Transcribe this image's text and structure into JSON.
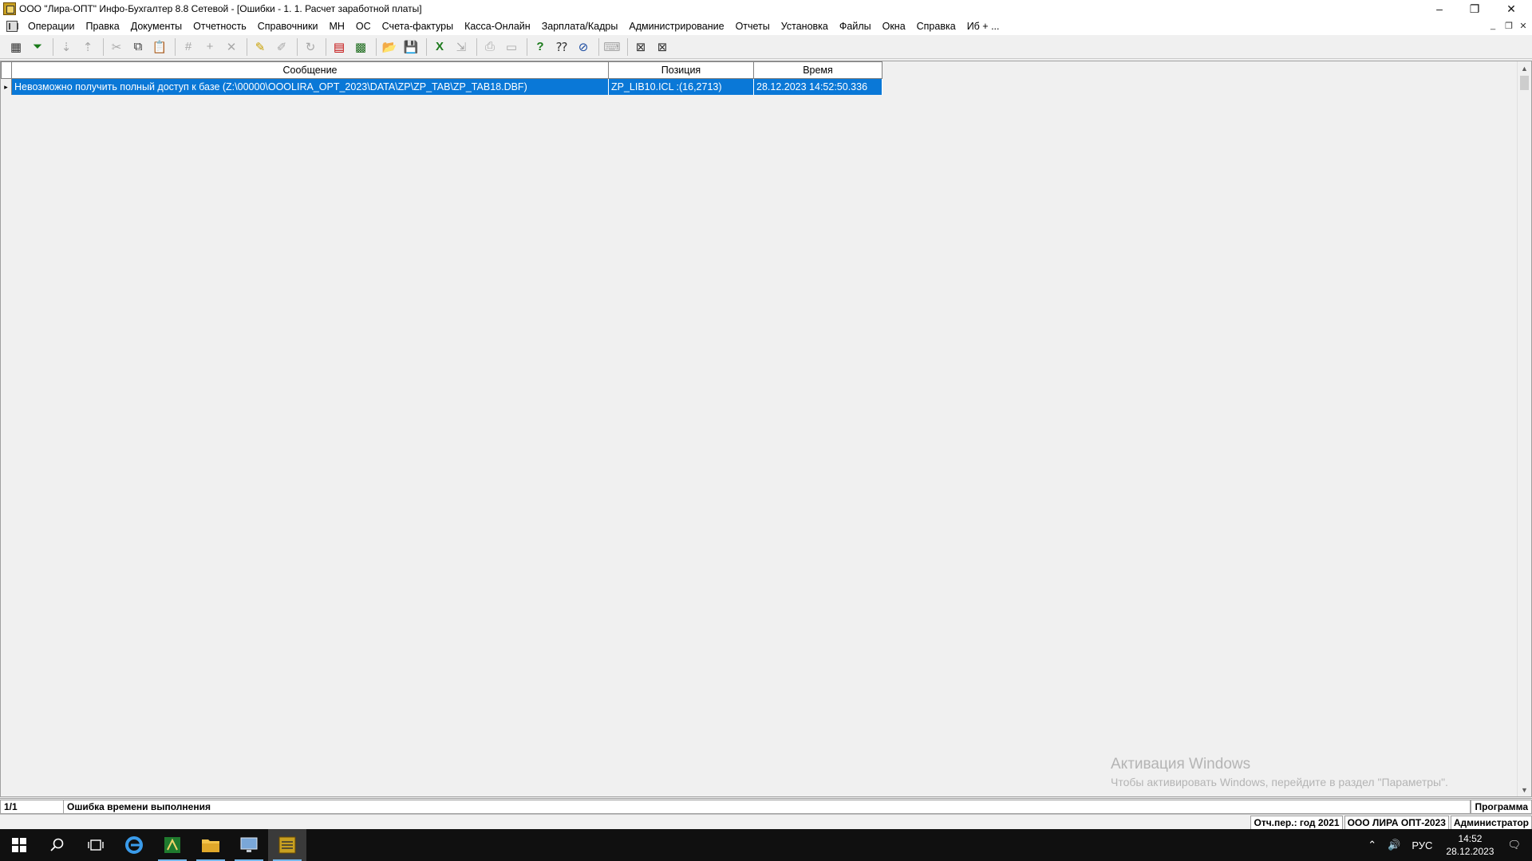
{
  "window": {
    "title": "ООО \"Лира-ОПТ\" Инфо-Бухгалтер 8.8 Сетевой - [Ошибки - 1. 1. Расчет заработной платы]",
    "controls": {
      "minimize": "–",
      "restore": "❐",
      "close": "✕"
    }
  },
  "menu": {
    "items": [
      "Операции",
      "Правка",
      "Документы",
      "Отчетность",
      "Справочники",
      "МН",
      "ОС",
      "Счета-фактуры",
      "Касса-Онлайн",
      "Зарплата/Кадры",
      "Администрирование",
      "Отчеты",
      "Установка",
      "Файлы",
      "Окна",
      "Справка",
      "Иб + ..."
    ],
    "mdi_controls": {
      "minimize": "_",
      "restore": "❐",
      "close": "✕"
    }
  },
  "toolbar": {
    "icons": [
      {
        "name": "table-view-icon",
        "glyph": "▦"
      },
      {
        "name": "filter-icon",
        "glyph": "⏷"
      },
      {
        "name": "sort-asc-icon",
        "glyph": "⇣"
      },
      {
        "name": "sort-desc-icon",
        "glyph": "⇡"
      },
      {
        "name": "cut-icon",
        "glyph": "✂"
      },
      {
        "name": "copy-icon",
        "glyph": "⧉"
      },
      {
        "name": "paste-icon",
        "glyph": "📋"
      },
      {
        "name": "numbering-icon",
        "glyph": "#"
      },
      {
        "name": "add-icon",
        "glyph": "+"
      },
      {
        "name": "delete-icon",
        "glyph": "✕"
      },
      {
        "name": "mark-icon",
        "glyph": "✎"
      },
      {
        "name": "unmark-icon",
        "glyph": "✐"
      },
      {
        "name": "refresh-icon",
        "glyph": "↻"
      },
      {
        "name": "pdf-icon",
        "glyph": "▤"
      },
      {
        "name": "calculator-icon",
        "glyph": "▩"
      },
      {
        "name": "open-folder-icon",
        "glyph": "📂"
      },
      {
        "name": "save-icon",
        "glyph": "💾"
      },
      {
        "name": "excel-icon",
        "glyph": "X"
      },
      {
        "name": "export-icon",
        "glyph": "⇲"
      },
      {
        "name": "print-icon",
        "glyph": "⎙"
      },
      {
        "name": "print-preview-icon",
        "glyph": "▭"
      },
      {
        "name": "help-icon",
        "glyph": "?"
      },
      {
        "name": "context-help-icon",
        "glyph": "⁇"
      },
      {
        "name": "compass-icon",
        "glyph": "⊘"
      },
      {
        "name": "keyboard-icon",
        "glyph": "⌨"
      },
      {
        "name": "close-window-icon",
        "glyph": "⊠"
      },
      {
        "name": "close-all-icon",
        "glyph": "⊠"
      }
    ]
  },
  "grid": {
    "columns": [
      "Сообщение",
      "Позиция",
      "Время"
    ],
    "rows": [
      {
        "message": "Невозможно получить полный доступ к базе  (Z:\\00000\\OOOLIRA_OPT_2023\\DATA\\ZP\\ZP_TAB\\ZP_TAB18.DBF)",
        "position": "ZP_LIB10.ICL :(16,2713)",
        "time": "28.12.2023 14:52:50.336"
      }
    ],
    "row_indicator": "▸",
    "scroll_up": "▲",
    "scroll_down": "▼"
  },
  "watermark": {
    "title": "Активация Windows",
    "subtitle": "Чтобы активировать Windows, перейдите в раздел \"Параметры\"."
  },
  "status": {
    "record": "1/1",
    "message": "Ошибка времени выполнения",
    "mode": "Программа"
  },
  "status2": {
    "period": "Отч.пер.: год 2021",
    "org": "ООО ЛИРА ОПТ-2023",
    "user": "Администратор"
  },
  "taskbar": {
    "tray": {
      "up": "⌃",
      "volume": "🔊",
      "lang": "РУС",
      "time": "14:52",
      "date": "28.12.2023",
      "notify": "🗨"
    }
  }
}
